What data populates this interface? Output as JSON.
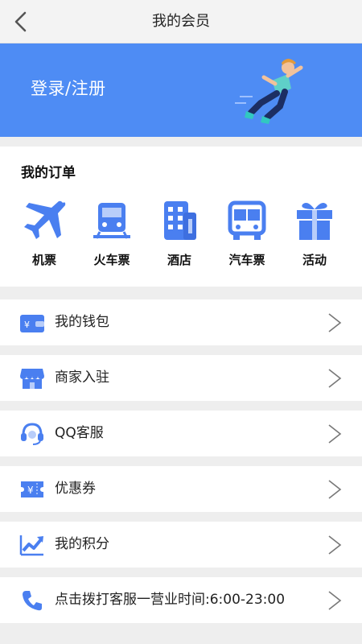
{
  "nav": {
    "title": "我的会员",
    "back_icon": "back-arrow-icon"
  },
  "banner": {
    "login_label": "登录/注册",
    "bg_color": "#4e8cf4",
    "illustration": "runner-illustration"
  },
  "orders": {
    "heading": "我的订单",
    "items": [
      {
        "label": "机票",
        "icon": "airplane-icon"
      },
      {
        "label": "火车票",
        "icon": "train-icon"
      },
      {
        "label": "酒店",
        "icon": "hotel-icon"
      },
      {
        "label": "汽车票",
        "icon": "bus-icon"
      },
      {
        "label": "活动",
        "icon": "gift-icon"
      }
    ]
  },
  "menu": [
    {
      "label": "我的钱包",
      "icon": "wallet-icon"
    },
    {
      "label": "商家入驻",
      "icon": "store-icon"
    },
    {
      "label": "QQ客服",
      "icon": "headset-icon"
    },
    {
      "label": "优惠券",
      "icon": "coupon-icon"
    },
    {
      "label": "我的积分",
      "icon": "trend-chart-icon"
    },
    {
      "label": "点击拨打客服一营业时间:6:00-23:00",
      "icon": "phone-icon"
    }
  ],
  "colors": {
    "accent": "#4e8cf4",
    "icon_blue": "#4a7ff0"
  }
}
